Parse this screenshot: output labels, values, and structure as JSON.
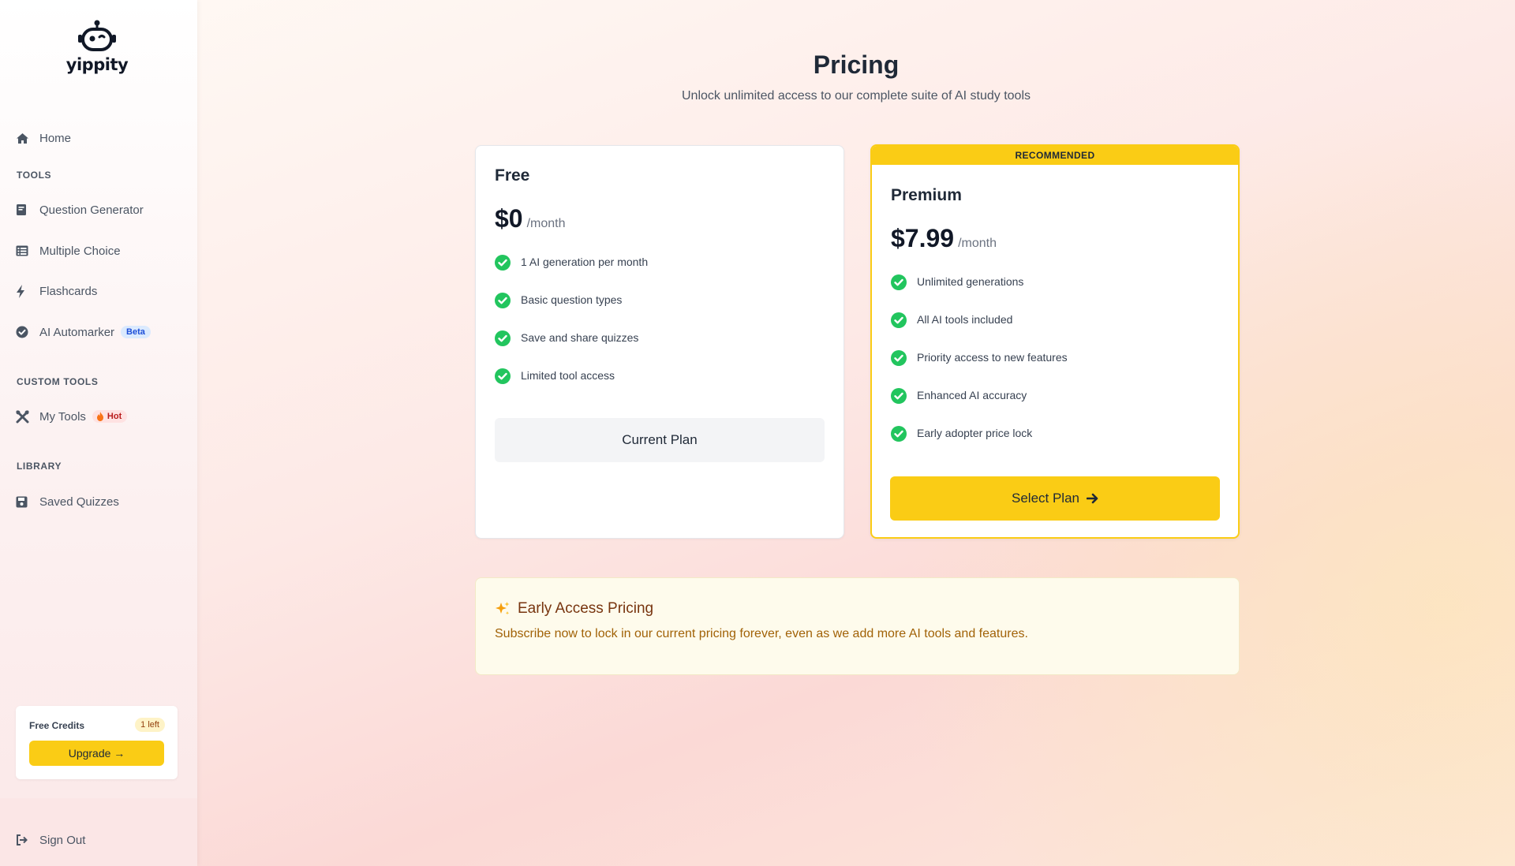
{
  "app": {
    "name": "yippity"
  },
  "sidebar": {
    "home": {
      "label": "Home",
      "icon": "home-icon"
    },
    "sections": {
      "tools": "TOOLS",
      "custom_tools": "CUSTOM TOOLS",
      "library": "LIBRARY"
    },
    "tools": [
      {
        "label": "Question Generator",
        "icon": "book-icon"
      },
      {
        "label": "Multiple Choice",
        "icon": "list-icon"
      },
      {
        "label": "Flashcards",
        "icon": "bolt-icon"
      },
      {
        "label": "AI Automarker",
        "icon": "check-circle-icon",
        "badge": "Beta"
      }
    ],
    "custom_tools": [
      {
        "label": "My Tools",
        "icon": "tools-icon",
        "badge": "Hot"
      }
    ],
    "library": [
      {
        "label": "Saved Quizzes",
        "icon": "save-icon"
      }
    ],
    "credits": {
      "label": "Free Credits",
      "remaining": "1 left",
      "upgrade_label": "Upgrade →"
    },
    "sign_out": "Sign Out"
  },
  "main": {
    "title": "Pricing",
    "subtitle": "Unlock unlimited access to our complete suite of AI study tools",
    "plans": [
      {
        "name": "Free",
        "price": "$0",
        "period": "/month",
        "features": [
          "1 AI generation per month",
          "Basic question types",
          "Save and share quizzes",
          "Limited tool access"
        ],
        "button": "Current Plan"
      },
      {
        "banner": "RECOMMENDED",
        "name": "Premium",
        "price": "$7.99",
        "period": "/month",
        "features": [
          "Unlimited generations",
          "All AI tools included",
          "Priority access to new features",
          "Enhanced AI accuracy",
          "Early adopter price lock"
        ],
        "button": "Select Plan"
      }
    ],
    "early_access": {
      "title": "Early Access Pricing",
      "text": "Subscribe now to lock in our current pricing forever, even as we add more AI tools and features."
    }
  },
  "colors": {
    "accent": "#facc15",
    "check": "#22c55e",
    "beta_badge": "#dbeafe",
    "hot_badge": "#fee2e2"
  }
}
